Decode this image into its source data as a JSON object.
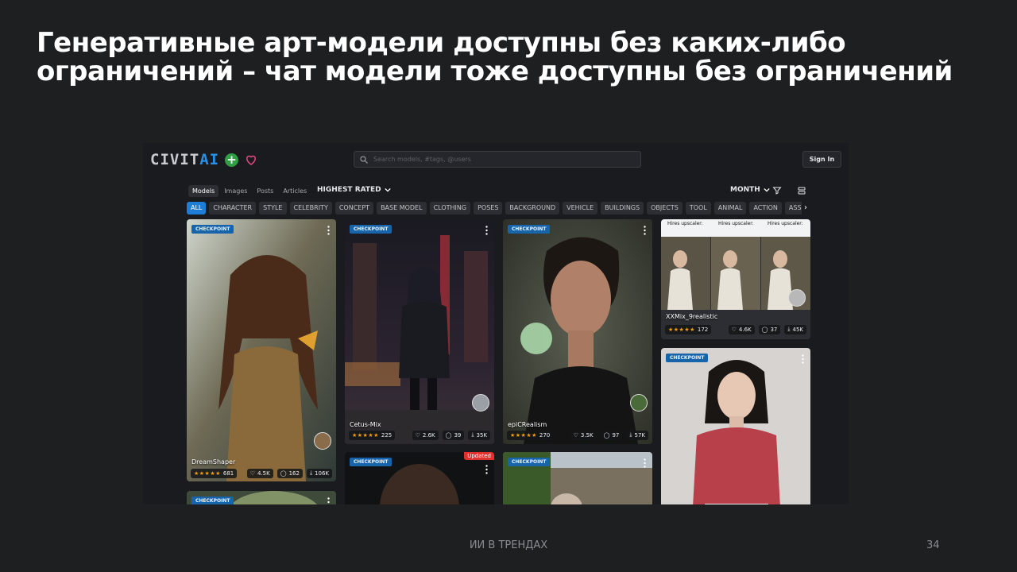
{
  "slide": {
    "title_line1": "Генеративные арт-модели доступны без каких-либо",
    "title_line2": "ограничений – чат модели тоже доступны без ограничений",
    "footer": "ИИ В ТРЕНДАХ",
    "page_number": "34"
  },
  "app": {
    "logo_text_left": "CIVIT",
    "logo_text_right": "AI",
    "search_placeholder": "Search models, #tags, @users",
    "signin_label": "Sign In"
  },
  "filters": {
    "types": [
      "Models",
      "Images",
      "Posts",
      "Articles"
    ],
    "active_type": "Models",
    "sort": "HIGHEST RATED",
    "period": "MONTH",
    "categories": [
      "ALL",
      "CHARACTER",
      "STYLE",
      "CELEBRITY",
      "CONCEPT",
      "BASE MODEL",
      "CLOTHING",
      "POSES",
      "BACKGROUND",
      "VEHICLE",
      "BUILDINGS",
      "OBJECTS",
      "TOOL",
      "ANIMAL",
      "ACTION",
      "ASSETS"
    ],
    "active_category": "ALL"
  },
  "cards": [
    {
      "badge": "CHECKPOINT",
      "name": "DreamShaper",
      "rating_count": "681",
      "likes": "4.5K",
      "comments": "162",
      "downloads": "106K"
    },
    {
      "badge": "CHECKPOINT",
      "name": "Cetus-Mix",
      "rating_count": "225",
      "likes": "2.6K",
      "comments": "39",
      "downloads": "35K"
    },
    {
      "badge": "CHECKPOINT",
      "name": "epiCRealism",
      "rating_count": "270",
      "likes": "3.5K",
      "comments": "97",
      "downloads": "57K"
    },
    {
      "badge": "",
      "name": "XXMix_9realistic",
      "rating_count": "172",
      "likes": "4.6K",
      "comments": "37",
      "downloads": "45K",
      "labels": [
        "Hires upscaler:",
        "Hires upscaler:",
        "Hires upscaler:"
      ]
    },
    {
      "badge": "CHECKPOINT",
      "name": ""
    },
    {
      "badge": "CHECKPOINT",
      "name": "",
      "updated": "Updated"
    },
    {
      "badge": "CHECKPOINT",
      "name": ""
    },
    {
      "badge": "CHECKPOINT",
      "name": ""
    }
  ],
  "stars": "★★★★★",
  "colors": {
    "accent": "#1c7ed6",
    "badge": "#1864ab",
    "stars": "#f59f00",
    "updated": "#e03131"
  }
}
